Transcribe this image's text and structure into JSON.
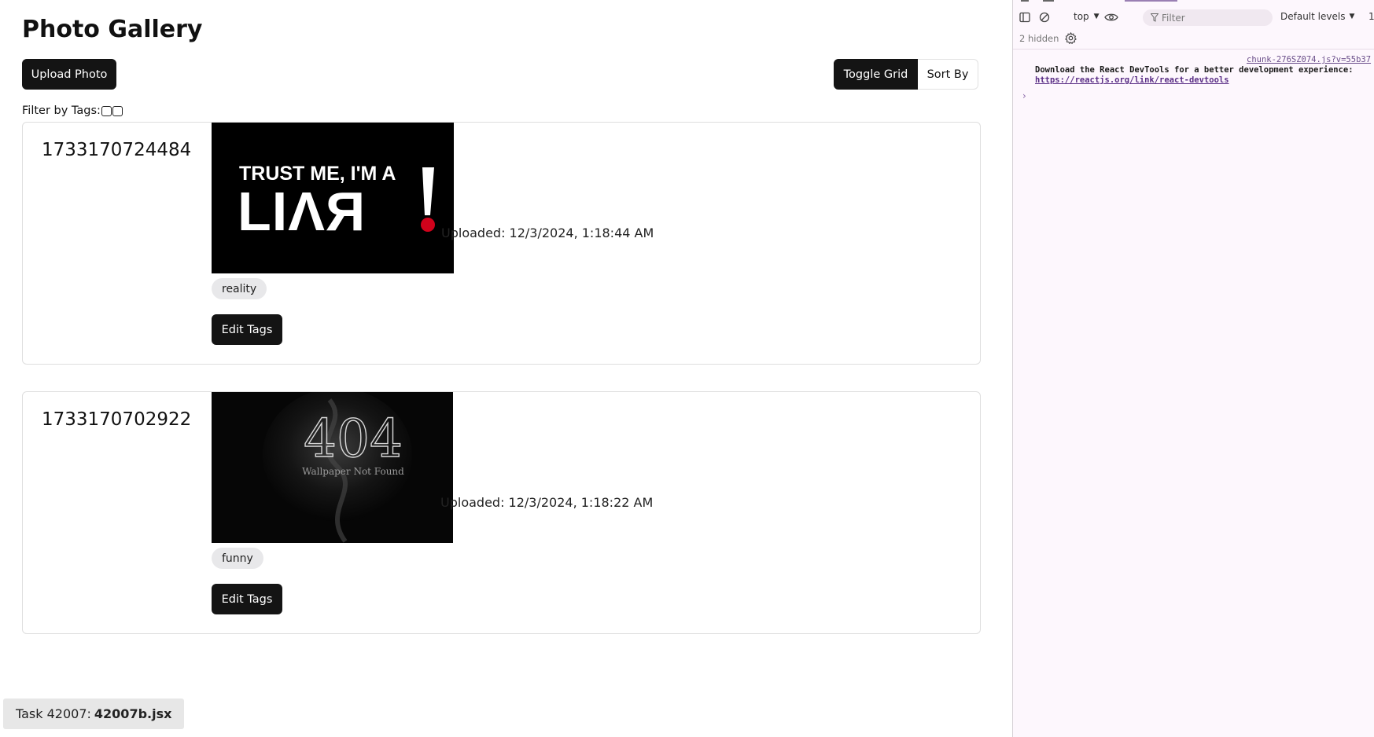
{
  "app": {
    "title": "Photo Gallery",
    "upload_label": "Upload Photo",
    "toggle_grid_label": "Toggle Grid",
    "sort_by_label": "Sort By",
    "filter_label": "Filter by Tags:"
  },
  "photos": [
    {
      "id": "1733170724484",
      "uploaded": "Uploaded: 12/3/2024, 1:18:44 AM",
      "tag": "reality",
      "edit_label": "Edit Tags",
      "image_text_top": "TRUST ME, I'M A",
      "image_text_main": "LIAR"
    },
    {
      "id": "1733170702922",
      "uploaded": "Uploaded: 12/3/2024, 1:18:22 AM",
      "tag": "funny",
      "edit_label": "Edit Tags",
      "image_text_top": "404",
      "image_text_main": "Wallpaper Not Found"
    }
  ],
  "task_badge": {
    "prefix": "Task 42007:",
    "file": "42007b.jsx"
  },
  "devtools": {
    "context": "top",
    "filter_placeholder": "Filter",
    "levels": "Default levels",
    "issues_count": "1",
    "hidden_label": "2 hidden",
    "message_source": "chunk-276SZ074.js?v=55b37",
    "message_text": "Download the React DevTools for a better development experience:",
    "message_link": "https://reactjs.org/link/react-devtools"
  },
  "colors": {
    "button_dark": "#141414",
    "tag_bg": "#e8e8ea",
    "devtools_bg": "#fdf7fd",
    "link_purple": "#5a2e86"
  }
}
